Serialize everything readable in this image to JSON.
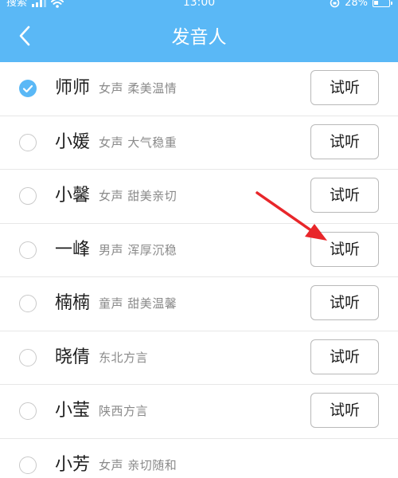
{
  "status_bar": {
    "carrier": "搜索",
    "time": "13:00",
    "battery_percent": "28%",
    "battery_level": 0.28
  },
  "header": {
    "title": "发音人",
    "back_icon": "chevron-left-icon",
    "background_color": "#5ab8f6"
  },
  "voices": [
    {
      "name": "师师",
      "description": "女声 柔美温情",
      "listen_label": "试听",
      "selected": true
    },
    {
      "name": "小媛",
      "description": "女声 大气稳重",
      "listen_label": "试听",
      "selected": false
    },
    {
      "name": "小馨",
      "description": "女声 甜美亲切",
      "listen_label": "试听",
      "selected": false
    },
    {
      "name": "一峰",
      "description": "男声 浑厚沉稳",
      "listen_label": "试听",
      "selected": false
    },
    {
      "name": "楠楠",
      "description": "童声 甜美温馨",
      "listen_label": "试听",
      "selected": false
    },
    {
      "name": "晓倩",
      "description": "东北方言",
      "listen_label": "试听",
      "selected": false
    },
    {
      "name": "小莹",
      "description": "陕西方言",
      "listen_label": "试听",
      "selected": false
    },
    {
      "name": "小芳",
      "description": "女声 亲切随和",
      "listen_label": "",
      "selected": false
    }
  ],
  "annotation": {
    "arrow_color": "#e8262a"
  }
}
